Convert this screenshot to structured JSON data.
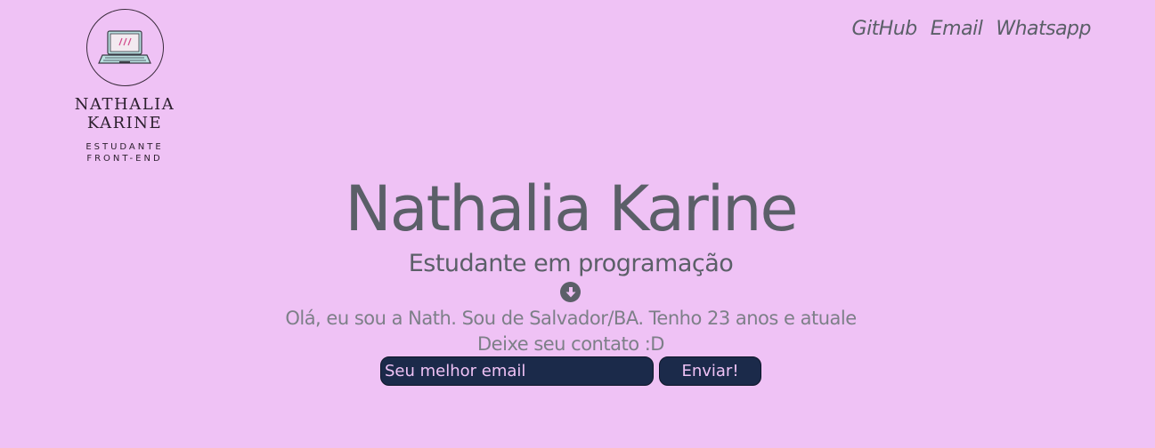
{
  "logo": {
    "icon": "laptop-icon",
    "name": "NATHALIA KARINE",
    "role_line1": "ESTUDANTE",
    "role_line2": "FRONT-END"
  },
  "nav": {
    "items": [
      {
        "label": "GitHub"
      },
      {
        "label": "Email"
      },
      {
        "label": "Whatsapp"
      }
    ]
  },
  "hero": {
    "title": "Nathalia Karine",
    "subtitle": "Estudante em programação",
    "scroll_icon": "arrow-down-circle-icon",
    "intro": "Olá, eu sou a Nath. Sou de Salvador/BA. Tenho 23 anos e atuale",
    "contact_prompt": "Deixe seu contato :D"
  },
  "form": {
    "email_placeholder": "Seu melhor email",
    "email_value": "",
    "submit_label": "Enviar!"
  },
  "colors": {
    "background": "#efc2f5",
    "text": "#5b5f68",
    "form_bg": "#1b2a4a"
  }
}
